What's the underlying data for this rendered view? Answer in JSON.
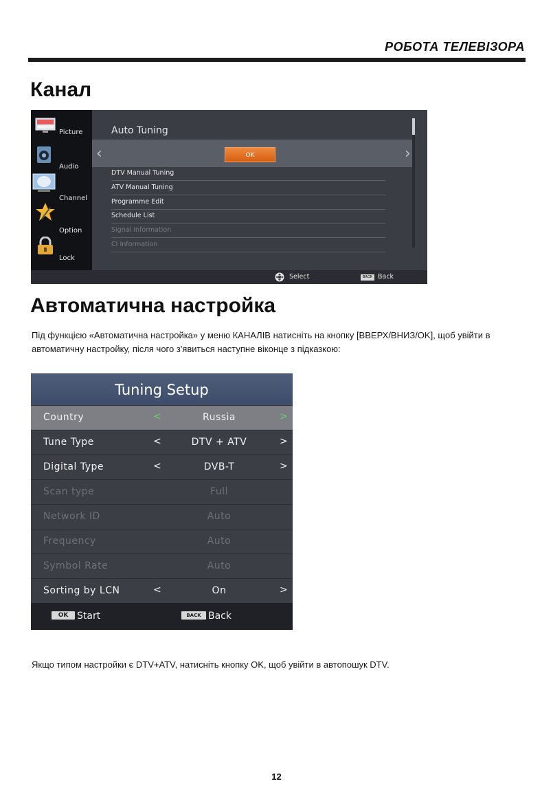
{
  "header": {
    "running_title": "РОБОТА ТЕЛЕВІЗОРА"
  },
  "section1": {
    "title": "Канал"
  },
  "channel_menu": {
    "categories": [
      {
        "label": "Picture",
        "icon": "picture-icon"
      },
      {
        "label": "Audio",
        "icon": "speaker-icon"
      },
      {
        "label": "Channel",
        "icon": "satellite-dish-icon"
      },
      {
        "label": "Option",
        "icon": "star-icon"
      },
      {
        "label": "Lock",
        "icon": "padlock-icon"
      }
    ],
    "title": "Auto Tuning",
    "ok_label": "OK",
    "left_arrow": "‹",
    "right_arrow": "›",
    "items": [
      {
        "label": "DTV Manual Tuning",
        "enabled": true
      },
      {
        "label": "ATV Manual Tuning",
        "enabled": true
      },
      {
        "label": "Programme Edit",
        "enabled": true
      },
      {
        "label": "Schedule List",
        "enabled": true
      },
      {
        "label": "Signal Information",
        "enabled": false
      },
      {
        "label": "CI Information",
        "enabled": false
      }
    ],
    "hints": {
      "select_label": "Select",
      "back_key": "BACK",
      "back_label": "Back"
    },
    "colors": {
      "ok_button": "#e8742a",
      "background": "#3a3d44"
    }
  },
  "section2": {
    "title": "Автоматична настройка",
    "paragraph": "Під функцією «Автоматична настройка» у меню КАНАЛІВ натисніть на кнопку [ВВЕРХ/ВНИЗ/OK], щоб увійти в автоматичну настройку, після чого з'явиться наступне віконце з підказкою:"
  },
  "tuning_setup": {
    "title": "Tuning Setup",
    "rows": [
      {
        "label": "Country",
        "value": "Russia",
        "state": "selected",
        "left": "<",
        "right": ">"
      },
      {
        "label": "Tune Type",
        "value": "DTV + ATV",
        "state": "enabled",
        "left": "<",
        "right": ">"
      },
      {
        "label": "Digital Type",
        "value": "DVB-T",
        "state": "enabled",
        "left": "<",
        "right": ">"
      },
      {
        "label": "Scan type",
        "value": "Full",
        "state": "disabled",
        "left": "",
        "right": ""
      },
      {
        "label": "Network ID",
        "value": "Auto",
        "state": "disabled",
        "left": "",
        "right": ""
      },
      {
        "label": "Frequency",
        "value": "Auto",
        "state": "disabled",
        "left": "",
        "right": ""
      },
      {
        "label": "Symbol Rate",
        "value": "Auto",
        "state": "disabled",
        "left": "",
        "right": ""
      },
      {
        "label": "Sorting by LCN",
        "value": "On",
        "state": "enabled",
        "left": "<",
        "right": ">"
      }
    ],
    "footer": {
      "ok_key": "OK",
      "start_label": "Start",
      "back_key": "BACK",
      "back_label": "Back"
    },
    "colors": {
      "title_bar": "#46566f",
      "selected_row": "#7d7f84",
      "selected_arrow": "#6ed16e"
    }
  },
  "note": {
    "text": "Якщо типом настройки є DTV+ATV, натисніть кнопку OK, щоб увійти в автопошук DTV."
  },
  "page_number": "12"
}
